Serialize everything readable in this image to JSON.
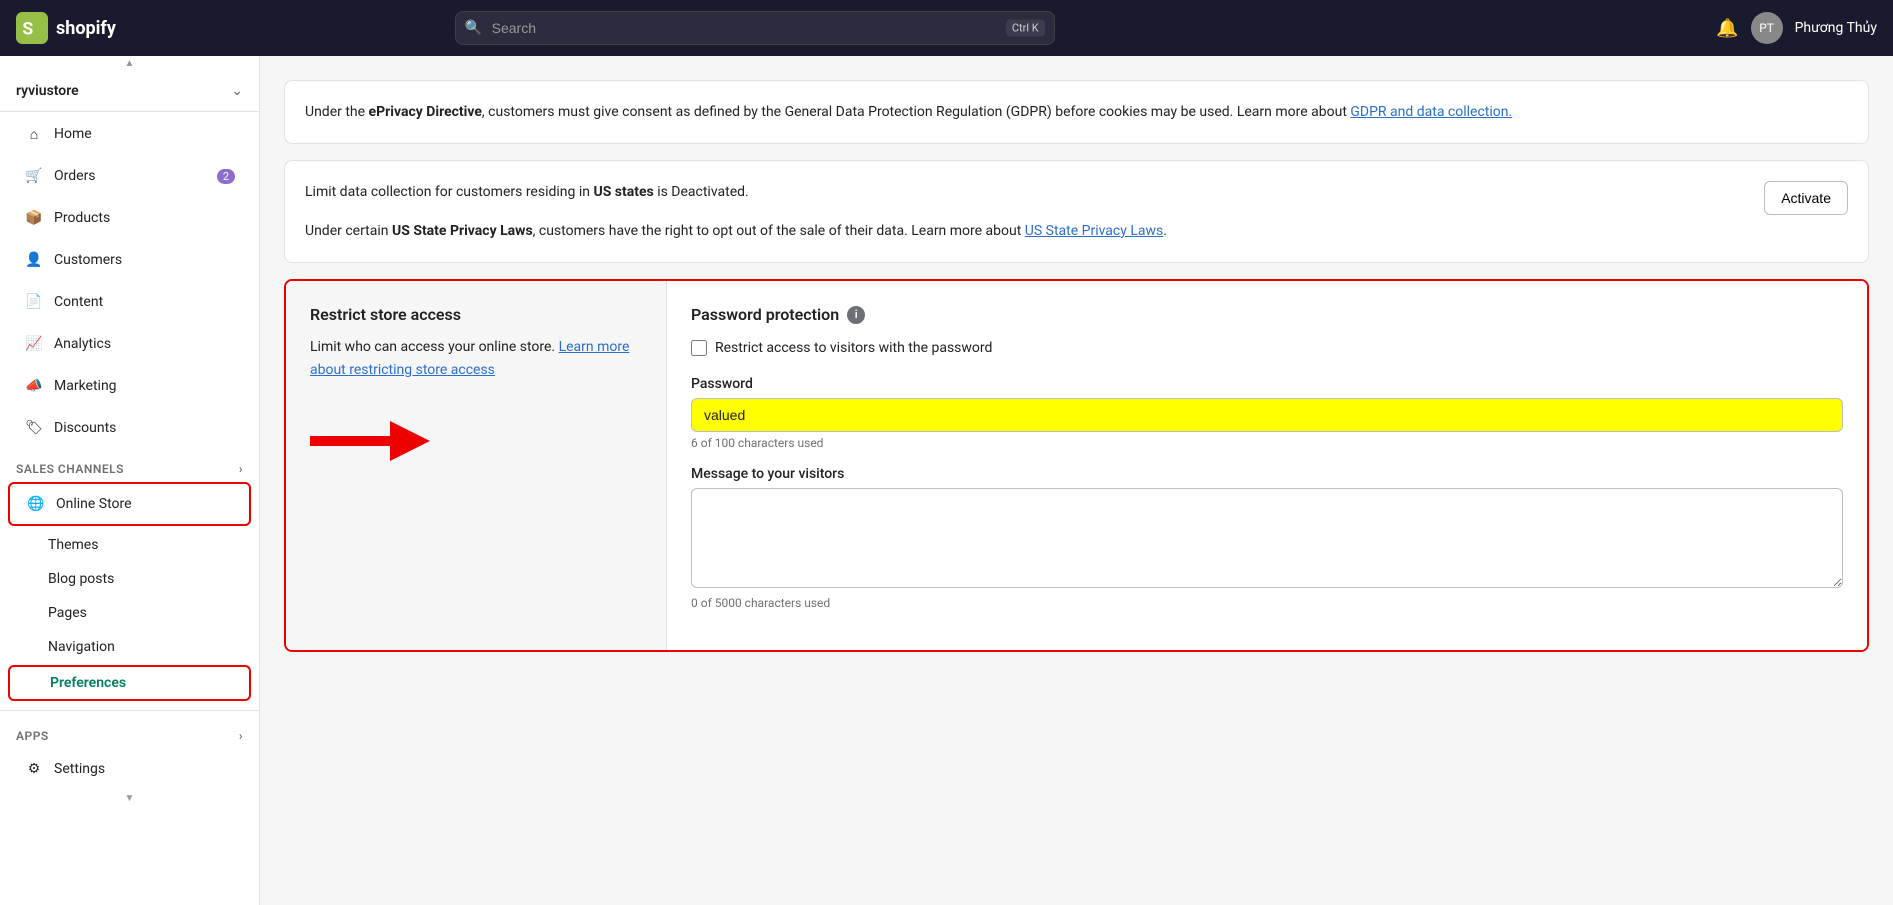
{
  "topbar": {
    "logo_text": "shopify",
    "search_placeholder": "Search",
    "shortcut": "Ctrl K",
    "notification_icon": "bell-icon",
    "user_name": "Phương Thủy"
  },
  "sidebar": {
    "store_name": "ryviustore",
    "nav_items": [
      {
        "id": "home",
        "label": "Home",
        "icon": "home-icon",
        "active": false
      },
      {
        "id": "orders",
        "label": "Orders",
        "icon": "orders-icon",
        "badge": "2",
        "active": false
      },
      {
        "id": "products",
        "label": "Products",
        "icon": "products-icon",
        "active": false
      },
      {
        "id": "customers",
        "label": "Customers",
        "icon": "customers-icon",
        "active": false
      },
      {
        "id": "content",
        "label": "Content",
        "icon": "content-icon",
        "active": false
      },
      {
        "id": "analytics",
        "label": "Analytics",
        "icon": "analytics-icon",
        "active": false
      },
      {
        "id": "marketing",
        "label": "Marketing",
        "icon": "marketing-icon",
        "active": false
      },
      {
        "id": "discounts",
        "label": "Discounts",
        "icon": "discounts-icon",
        "active": false
      }
    ],
    "sales_channels_label": "Sales channels",
    "online_store_label": "Online Store",
    "sub_items": [
      {
        "id": "themes",
        "label": "Themes",
        "active": false
      },
      {
        "id": "blog-posts",
        "label": "Blog posts",
        "active": false
      },
      {
        "id": "pages",
        "label": "Pages",
        "active": false
      },
      {
        "id": "navigation",
        "label": "Navigation",
        "active": false
      },
      {
        "id": "preferences",
        "label": "Preferences",
        "active": true
      }
    ],
    "apps_label": "Apps",
    "settings_label": "Settings"
  },
  "content": {
    "gdpr_card": {
      "text_before": "Under the ",
      "bold1": "ePrivacy Directive",
      "text_middle": ", customers must give consent as defined by the General Data Protection Regulation (GDPR) before cookies may be used. Learn more about ",
      "link_text": "GDPR and data collection.",
      "text_after": ""
    },
    "us_states_card": {
      "text1_before": "Limit data collection for customers residing in ",
      "bold1": "US states",
      "text1_after": " is Deactivated.",
      "text2_before": "Under certain ",
      "bold2": "US State Privacy Laws",
      "text2_middle": ", customers have the right to opt out of the sale of their data. Learn more about ",
      "link_text": "US State Privacy Laws",
      "text2_after": ".",
      "activate_button": "Activate"
    },
    "restrict_section": {
      "left_title": "Restrict store access",
      "left_desc_before": "Limit who can access your online store. ",
      "left_link": "Learn more about restricting store access",
      "right_title": "Password protection",
      "checkbox_label": "Restrict access to visitors with the password",
      "password_label": "Password",
      "password_value": "valued",
      "char_count": "6 of 100 characters used",
      "message_label": "Message to your visitors",
      "message_value": "",
      "message_char_count": "0 of 5000 characters used"
    }
  }
}
